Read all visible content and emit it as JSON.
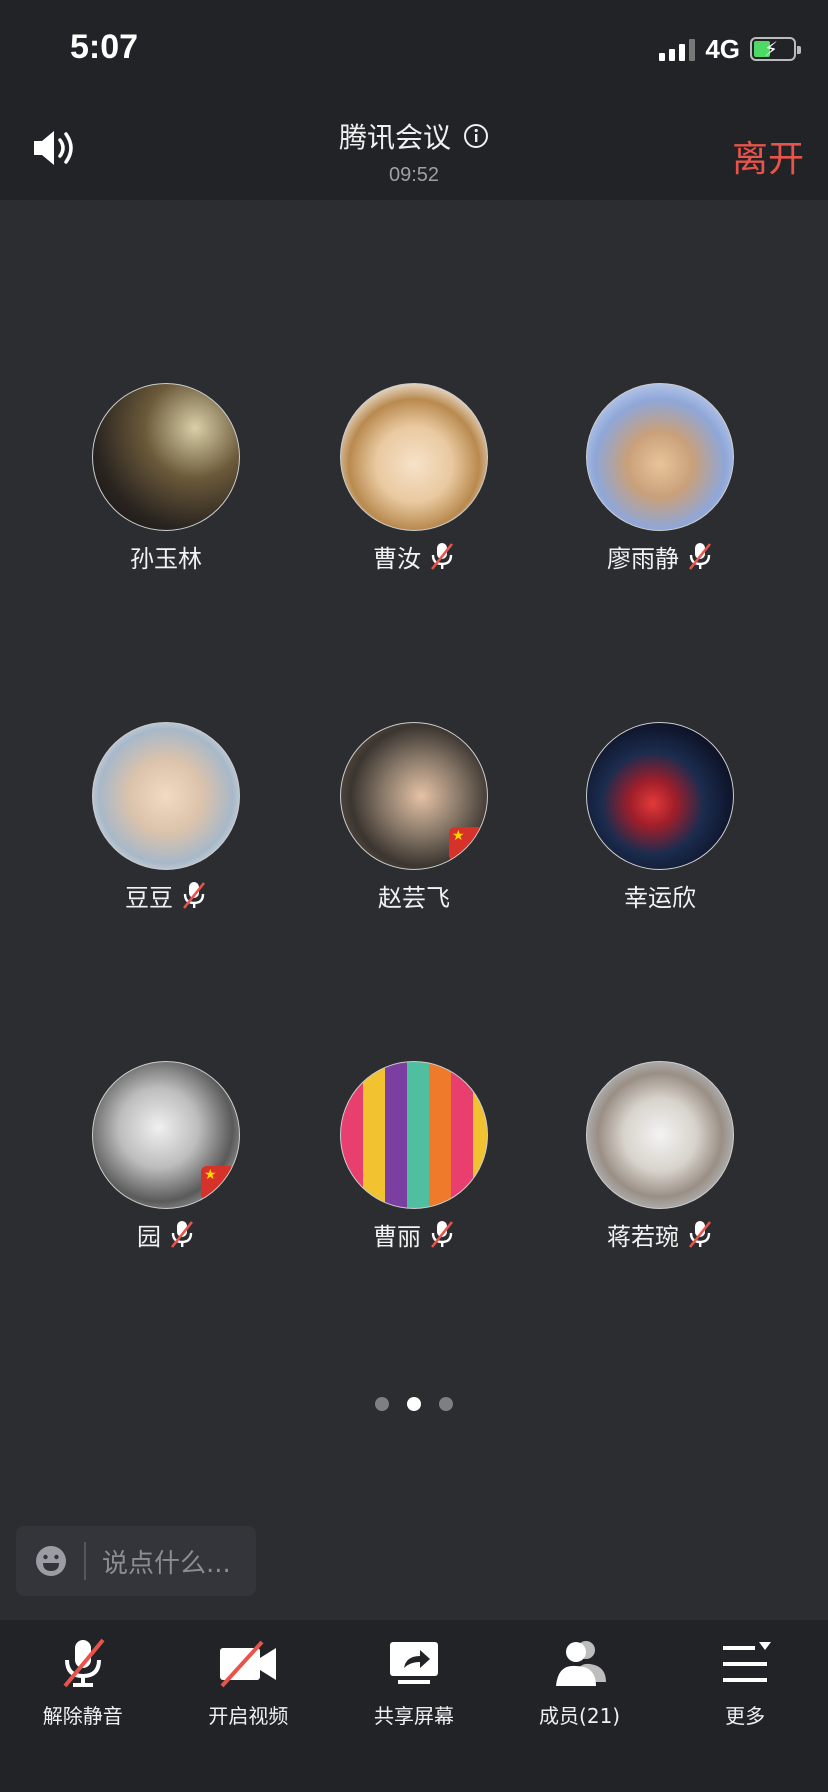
{
  "status_bar": {
    "time": "5:07",
    "network": "4G"
  },
  "header": {
    "title": "腾讯会议",
    "duration": "09:52",
    "leave_label": "离开"
  },
  "participants": [
    {
      "name": "孙玉林",
      "muted": false,
      "flag": false
    },
    {
      "name": "曹汝",
      "muted": true,
      "flag": false
    },
    {
      "name": "廖雨静",
      "muted": true,
      "flag": false
    },
    {
      "name": "豆豆",
      "muted": true,
      "flag": false
    },
    {
      "name": "赵芸飞",
      "muted": false,
      "flag": true
    },
    {
      "name": "幸运欣",
      "muted": false,
      "flag": false
    },
    {
      "name": "园",
      "muted": true,
      "flag": true
    },
    {
      "name": "曹丽",
      "muted": true,
      "flag": false
    },
    {
      "name": "蒋若琬",
      "muted": true,
      "flag": false
    }
  ],
  "pager": {
    "pages": 3,
    "current": 2
  },
  "chat": {
    "placeholder": "说点什么..."
  },
  "toolbar": {
    "unmute_label": "解除静音",
    "video_label": "开启视频",
    "share_label": "共享屏幕",
    "members_label": "成员(21)",
    "more_label": "更多"
  },
  "colors": {
    "accent_leave": "#e8544b",
    "background": "#2b2d31",
    "bar": "#222327"
  }
}
